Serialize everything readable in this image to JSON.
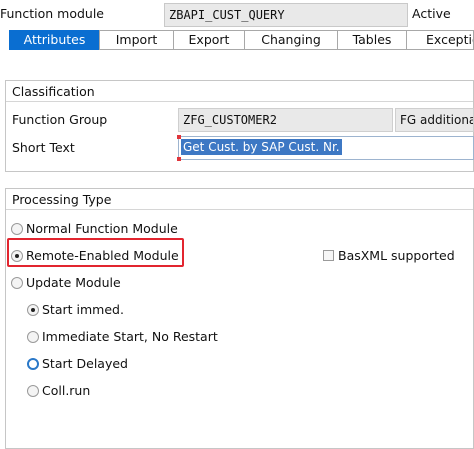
{
  "header": {
    "label": "Function module",
    "name_value": "ZBAPI_CUST_QUERY",
    "status": "Active"
  },
  "tabs": [
    {
      "label": "Attributes",
      "active": true
    },
    {
      "label": "Import",
      "active": false
    },
    {
      "label": "Export",
      "active": false
    },
    {
      "label": "Changing",
      "active": false
    },
    {
      "label": "Tables",
      "active": false
    },
    {
      "label": "Exceptio",
      "active": false
    }
  ],
  "classification": {
    "title": "Classification",
    "function_group_label": "Function Group",
    "function_group_value": "ZFG_CUSTOMER2",
    "function_group_desc": "FG additional I",
    "short_text_label": "Short Text",
    "short_text_value": "Get Cust. by SAP Cust. Nr."
  },
  "processing_type": {
    "title": "Processing Type",
    "options": {
      "normal": {
        "label": "Normal Function Module",
        "checked": false
      },
      "remote": {
        "label": "Remote-Enabled Module",
        "checked": true
      },
      "update": {
        "label": "Update Module",
        "checked": false
      }
    },
    "basxml": {
      "label": "BasXML supported",
      "checked": false
    },
    "update_sub": {
      "start_immed": {
        "label": "Start immed.",
        "checked": true
      },
      "immediate_no_restart": {
        "label": "Immediate Start, No Restart",
        "checked": false
      },
      "start_delayed": {
        "label": "Start Delayed",
        "checked": false
      },
      "coll_run": {
        "label": "Coll.run",
        "checked": false
      }
    }
  },
  "colors": {
    "accent": "#0a6ed1",
    "highlight": "#e2252f",
    "selection": "#3d78c4"
  }
}
